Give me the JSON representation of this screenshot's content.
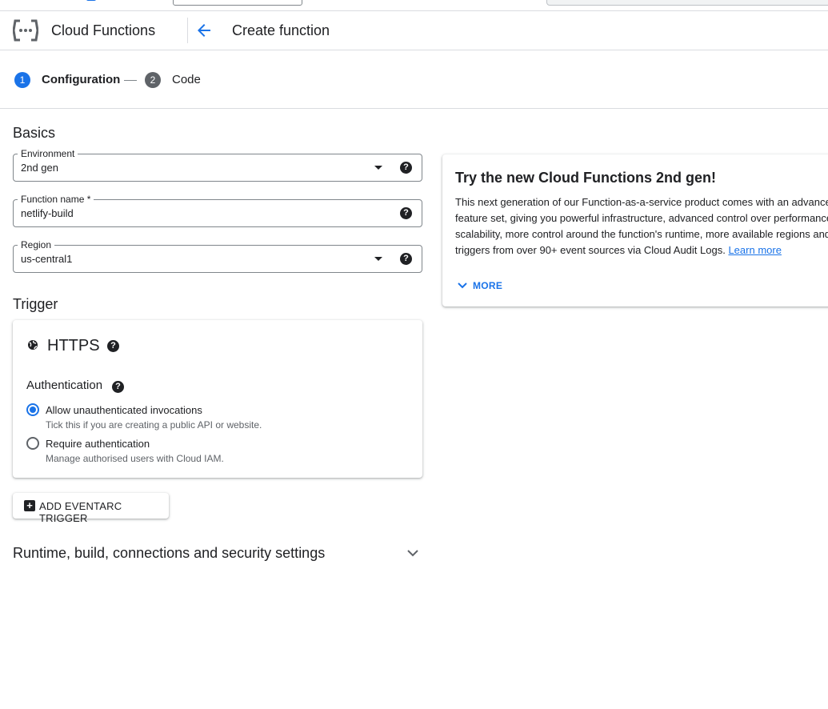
{
  "colors": {
    "accent": "#1a73e8",
    "text": "#202124",
    "muted": "#5f6368",
    "border": "#dadce0"
  },
  "header": {
    "product_title": "Cloud Functions",
    "page_title": "Create function",
    "logo_icon": "cloud-functions-logo-icon",
    "back_icon": "arrow-back-icon"
  },
  "stepper": {
    "steps": [
      {
        "number": "1",
        "label": "Configuration",
        "active": true
      },
      {
        "number": "2",
        "label": "Code",
        "active": false
      }
    ]
  },
  "basics": {
    "title": "Basics",
    "environment": {
      "label": "Environment",
      "value": "2nd gen"
    },
    "function_name": {
      "label": "Function name *",
      "value": "netlify-build"
    },
    "region": {
      "label": "Region",
      "value": "us-central1"
    },
    "help_glyph": "?"
  },
  "trigger": {
    "title": "Trigger",
    "type": "HTTPS",
    "auth_title": "Authentication",
    "options": [
      {
        "label": "Allow unauthenticated invocations",
        "hint": "Tick this if you are creating a public API or website.",
        "selected": true
      },
      {
        "label": "Require authentication",
        "hint": "Manage authorised users with Cloud IAM.",
        "selected": false
      }
    ],
    "add_button": "ADD EVENTARC TRIGGER",
    "add_glyph": "+"
  },
  "runtime": {
    "title": "Runtime, build, connections and security settings"
  },
  "promo": {
    "title": "Try the new Cloud Functions 2nd gen!",
    "lines": [
      "This next generation of our Function-as-a-service product comes with an advanced",
      "feature set, giving you powerful infrastructure, advanced control over performance,",
      "scalability, more control around the function's runtime, more available regions and",
      "triggers from over 90+ event sources via Cloud Audit Logs."
    ],
    "link": "Learn more",
    "more": "MORE"
  }
}
